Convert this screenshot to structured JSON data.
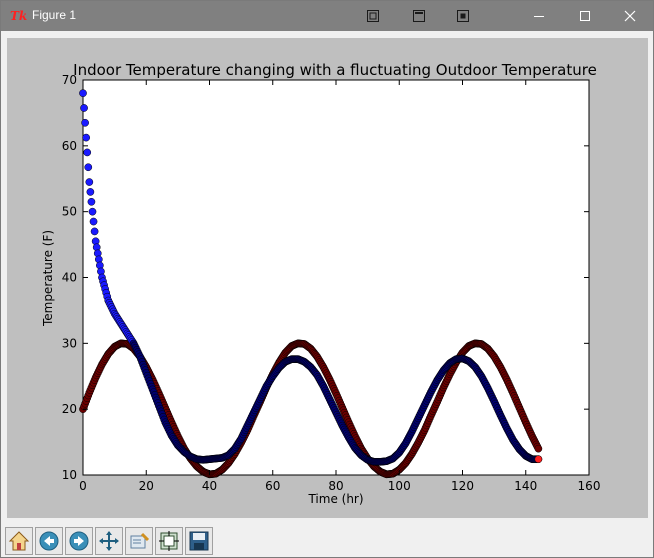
{
  "window": {
    "title": "Figure 1",
    "app_icon_text": "Tk"
  },
  "toolbar": {
    "tools": [
      {
        "name": "home-icon"
      },
      {
        "name": "back-icon"
      },
      {
        "name": "forward-icon"
      },
      {
        "name": "pan-icon"
      },
      {
        "name": "zoom-icon"
      },
      {
        "name": "configure-subplots-icon"
      },
      {
        "name": "save-icon"
      }
    ]
  },
  "colors": {
    "indoor": "#00006e",
    "outdoor": "#6b0000",
    "indoor_start": "#1a1aff",
    "outdoor_end": "#ff2020",
    "figure_bg": "#bfbfbf"
  },
  "chart_data": {
    "type": "scatter",
    "title": "Indoor Temperature changing with a fluctuating Outdoor Temperature",
    "xlabel": "Time (hr)",
    "ylabel": "Temperature (F)",
    "xlim": [
      0,
      160
    ],
    "ylim": [
      10,
      70
    ],
    "xticks": [
      "0",
      "20",
      "40",
      "60",
      "80",
      "100",
      "120",
      "140",
      "160"
    ],
    "yticks": [
      "10",
      "20",
      "30",
      "40",
      "50",
      "60",
      "70"
    ],
    "grid": false,
    "legend": "none",
    "series": [
      {
        "x": [
          0,
          2,
          4,
          6,
          8,
          10,
          12,
          14,
          16,
          18,
          20,
          22,
          24,
          26,
          28,
          30,
          32,
          34,
          36,
          38,
          40,
          42,
          44,
          46,
          48,
          50,
          52,
          54,
          56,
          58,
          60,
          62,
          64,
          66,
          68,
          70,
          72,
          74,
          76,
          78,
          80,
          82,
          84,
          86,
          88,
          90,
          92,
          94,
          96,
          98,
          100,
          102,
          104,
          106,
          108,
          110,
          112,
          114,
          116,
          118,
          120,
          122,
          124,
          126,
          128,
          130,
          132,
          134,
          136,
          138,
          140,
          142,
          144
        ],
        "y": [
          68,
          54.5,
          45.5,
          40,
          36.5,
          34.5,
          33,
          31.5,
          30,
          28,
          25.5,
          23,
          20.5,
          18,
          16,
          14.5,
          13.5,
          12.8,
          12.4,
          12.3,
          12.4,
          12.5,
          12.6,
          13,
          14,
          15.5,
          17.5,
          19.5,
          21.5,
          23.5,
          25,
          26.3,
          27.2,
          27.6,
          27.6,
          27.2,
          26.4,
          25.2,
          23.5,
          21.5,
          19.5,
          17.5,
          15.7,
          14.1,
          13,
          12.3,
          12,
          12,
          12.1,
          12.5,
          13.4,
          14.8,
          16.6,
          18.6,
          20.6,
          22.6,
          24.4,
          25.9,
          27,
          27.6,
          27.7,
          27.3,
          26.4,
          25,
          23.2,
          21.2,
          19.1,
          17.1,
          15.3,
          13.9,
          12.9,
          12.4,
          12.4
        ]
      },
      {
        "x": [
          0,
          2,
          4,
          6,
          8,
          10,
          12,
          14,
          16,
          18,
          20,
          22,
          24,
          26,
          28,
          30,
          32,
          34,
          36,
          38,
          40,
          42,
          44,
          46,
          48,
          50,
          52,
          54,
          56,
          58,
          60,
          62,
          64,
          66,
          68,
          70,
          72,
          74,
          76,
          78,
          80,
          82,
          84,
          86,
          88,
          90,
          92,
          94,
          96,
          98,
          100,
          102,
          104,
          106,
          108,
          110,
          112,
          114,
          116,
          118,
          120,
          122,
          124,
          126,
          128,
          130,
          132,
          134,
          136,
          138,
          140,
          142,
          144
        ],
        "y": [
          20,
          22.5,
          24.8,
          26.8,
          28.4,
          29.5,
          30,
          29.9,
          29.2,
          28,
          26.4,
          24.5,
          22.4,
          20.2,
          18,
          15.9,
          14,
          12.5,
          11.3,
          10.5,
          10.1,
          10.2,
          10.8,
          11.8,
          13.2,
          14.9,
          16.8,
          19,
          21.1,
          23.3,
          25.3,
          27.1,
          28.6,
          29.6,
          30,
          29.9,
          29.2,
          28,
          26.4,
          24.5,
          22.4,
          20.2,
          18,
          15.9,
          14,
          12.5,
          11.3,
          10.5,
          10.1,
          10.2,
          10.8,
          11.8,
          13.2,
          14.9,
          16.8,
          19,
          21.1,
          23.3,
          25.3,
          27.1,
          28.6,
          29.6,
          30,
          29.9,
          29.2,
          28,
          26.4,
          24.5,
          22.4,
          20.2,
          18,
          15.9,
          14
        ]
      }
    ]
  }
}
